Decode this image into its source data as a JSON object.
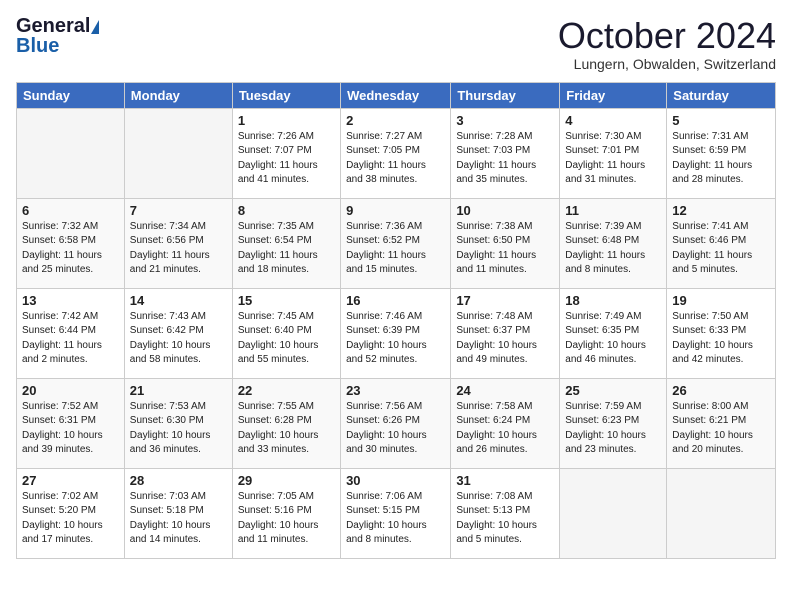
{
  "logo": {
    "general": "General",
    "blue": "Blue"
  },
  "title": {
    "month": "October 2024",
    "location": "Lungern, Obwalden, Switzerland"
  },
  "weekdays": [
    "Sunday",
    "Monday",
    "Tuesday",
    "Wednesday",
    "Thursday",
    "Friday",
    "Saturday"
  ],
  "weeks": [
    [
      {
        "day": "",
        "info": ""
      },
      {
        "day": "",
        "info": ""
      },
      {
        "day": "1",
        "info": "Sunrise: 7:26 AM\nSunset: 7:07 PM\nDaylight: 11 hours\nand 41 minutes."
      },
      {
        "day": "2",
        "info": "Sunrise: 7:27 AM\nSunset: 7:05 PM\nDaylight: 11 hours\nand 38 minutes."
      },
      {
        "day": "3",
        "info": "Sunrise: 7:28 AM\nSunset: 7:03 PM\nDaylight: 11 hours\nand 35 minutes."
      },
      {
        "day": "4",
        "info": "Sunrise: 7:30 AM\nSunset: 7:01 PM\nDaylight: 11 hours\nand 31 minutes."
      },
      {
        "day": "5",
        "info": "Sunrise: 7:31 AM\nSunset: 6:59 PM\nDaylight: 11 hours\nand 28 minutes."
      }
    ],
    [
      {
        "day": "6",
        "info": "Sunrise: 7:32 AM\nSunset: 6:58 PM\nDaylight: 11 hours\nand 25 minutes."
      },
      {
        "day": "7",
        "info": "Sunrise: 7:34 AM\nSunset: 6:56 PM\nDaylight: 11 hours\nand 21 minutes."
      },
      {
        "day": "8",
        "info": "Sunrise: 7:35 AM\nSunset: 6:54 PM\nDaylight: 11 hours\nand 18 minutes."
      },
      {
        "day": "9",
        "info": "Sunrise: 7:36 AM\nSunset: 6:52 PM\nDaylight: 11 hours\nand 15 minutes."
      },
      {
        "day": "10",
        "info": "Sunrise: 7:38 AM\nSunset: 6:50 PM\nDaylight: 11 hours\nand 11 minutes."
      },
      {
        "day": "11",
        "info": "Sunrise: 7:39 AM\nSunset: 6:48 PM\nDaylight: 11 hours\nand 8 minutes."
      },
      {
        "day": "12",
        "info": "Sunrise: 7:41 AM\nSunset: 6:46 PM\nDaylight: 11 hours\nand 5 minutes."
      }
    ],
    [
      {
        "day": "13",
        "info": "Sunrise: 7:42 AM\nSunset: 6:44 PM\nDaylight: 11 hours\nand 2 minutes."
      },
      {
        "day": "14",
        "info": "Sunrise: 7:43 AM\nSunset: 6:42 PM\nDaylight: 10 hours\nand 58 minutes."
      },
      {
        "day": "15",
        "info": "Sunrise: 7:45 AM\nSunset: 6:40 PM\nDaylight: 10 hours\nand 55 minutes."
      },
      {
        "day": "16",
        "info": "Sunrise: 7:46 AM\nSunset: 6:39 PM\nDaylight: 10 hours\nand 52 minutes."
      },
      {
        "day": "17",
        "info": "Sunrise: 7:48 AM\nSunset: 6:37 PM\nDaylight: 10 hours\nand 49 minutes."
      },
      {
        "day": "18",
        "info": "Sunrise: 7:49 AM\nSunset: 6:35 PM\nDaylight: 10 hours\nand 46 minutes."
      },
      {
        "day": "19",
        "info": "Sunrise: 7:50 AM\nSunset: 6:33 PM\nDaylight: 10 hours\nand 42 minutes."
      }
    ],
    [
      {
        "day": "20",
        "info": "Sunrise: 7:52 AM\nSunset: 6:31 PM\nDaylight: 10 hours\nand 39 minutes."
      },
      {
        "day": "21",
        "info": "Sunrise: 7:53 AM\nSunset: 6:30 PM\nDaylight: 10 hours\nand 36 minutes."
      },
      {
        "day": "22",
        "info": "Sunrise: 7:55 AM\nSunset: 6:28 PM\nDaylight: 10 hours\nand 33 minutes."
      },
      {
        "day": "23",
        "info": "Sunrise: 7:56 AM\nSunset: 6:26 PM\nDaylight: 10 hours\nand 30 minutes."
      },
      {
        "day": "24",
        "info": "Sunrise: 7:58 AM\nSunset: 6:24 PM\nDaylight: 10 hours\nand 26 minutes."
      },
      {
        "day": "25",
        "info": "Sunrise: 7:59 AM\nSunset: 6:23 PM\nDaylight: 10 hours\nand 23 minutes."
      },
      {
        "day": "26",
        "info": "Sunrise: 8:00 AM\nSunset: 6:21 PM\nDaylight: 10 hours\nand 20 minutes."
      }
    ],
    [
      {
        "day": "27",
        "info": "Sunrise: 7:02 AM\nSunset: 5:20 PM\nDaylight: 10 hours\nand 17 minutes."
      },
      {
        "day": "28",
        "info": "Sunrise: 7:03 AM\nSunset: 5:18 PM\nDaylight: 10 hours\nand 14 minutes."
      },
      {
        "day": "29",
        "info": "Sunrise: 7:05 AM\nSunset: 5:16 PM\nDaylight: 10 hours\nand 11 minutes."
      },
      {
        "day": "30",
        "info": "Sunrise: 7:06 AM\nSunset: 5:15 PM\nDaylight: 10 hours\nand 8 minutes."
      },
      {
        "day": "31",
        "info": "Sunrise: 7:08 AM\nSunset: 5:13 PM\nDaylight: 10 hours\nand 5 minutes."
      },
      {
        "day": "",
        "info": ""
      },
      {
        "day": "",
        "info": ""
      }
    ]
  ]
}
